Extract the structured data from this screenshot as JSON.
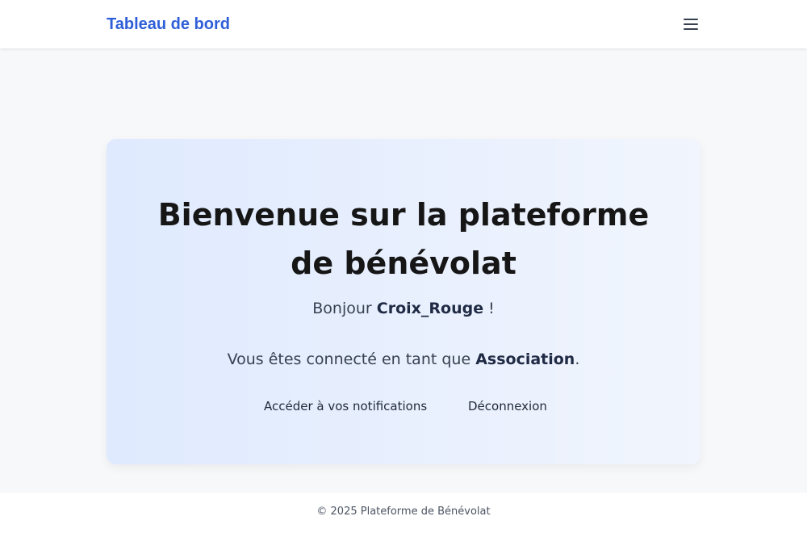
{
  "navbar": {
    "brand": "Tableau de bord",
    "menu_icon": "hamburger-menu-icon",
    "brand_color": "#2f5fd8"
  },
  "hero": {
    "title": "Bienvenue sur la plateforme de bénévolat",
    "greeting_prefix": "Bonjour ",
    "username": "Croix_Rouge",
    "greeting_suffix": " !",
    "role_prefix": "Vous êtes connecté en tant que ",
    "role": "Association",
    "role_suffix": "."
  },
  "actions": {
    "notifications_label": "Accéder à vos notifications",
    "logout_label": "Déconnexion"
  },
  "footer": {
    "text": "© 2025 Plateforme de Bénévolat"
  }
}
